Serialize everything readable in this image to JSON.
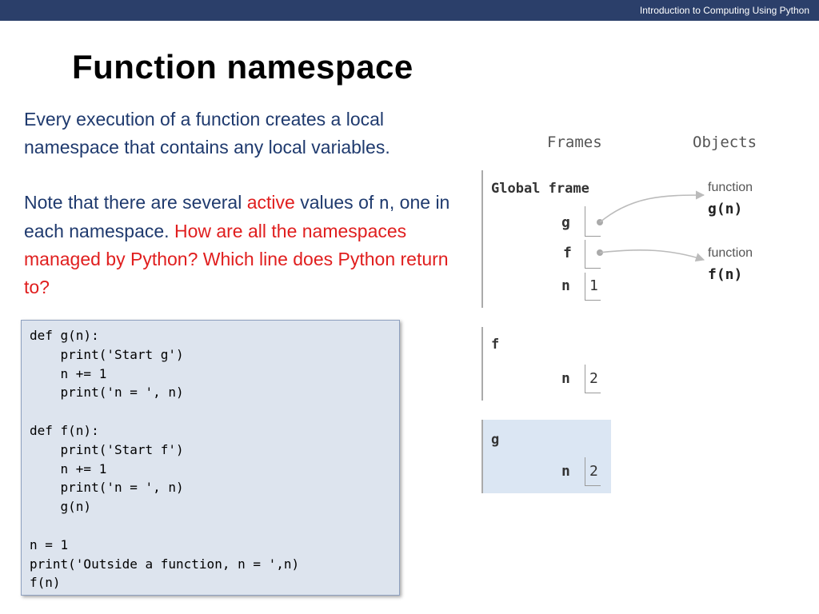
{
  "header": {
    "course": "Introduction to Computing Using Python"
  },
  "slide": {
    "title": "Function namespace",
    "para1": "Every execution of a function creates a local namespace that contains any local variables.",
    "para2_a": "Note that there are several ",
    "para2_active": "active",
    "para2_b": " values of ",
    "para2_code": "n",
    "para2_c": ", one in each namespace. ",
    "para2_question": "How are all the namespaces managed by Python? Which line does Python return to?"
  },
  "code": "def g(n):\n    print('Start g')\n    n += 1\n    print('n = ', n)\n\ndef f(n):\n    print('Start f')\n    n += 1\n    print('n = ', n)\n    g(n)\n\nn = 1\nprint('Outside a function, n = ',n)\nf(n)",
  "visualization": {
    "frames_header": "Frames",
    "objects_header": "Objects",
    "global_frame": {
      "title": "Global frame",
      "vars": [
        {
          "name": "g",
          "value": ""
        },
        {
          "name": "f",
          "value": ""
        },
        {
          "name": "n",
          "value": "1"
        }
      ]
    },
    "f_frame": {
      "title": "f",
      "vars": [
        {
          "name": "n",
          "value": "2"
        }
      ]
    },
    "g_frame": {
      "title": "g",
      "vars": [
        {
          "name": "n",
          "value": "2"
        }
      ]
    },
    "objects": [
      {
        "type": "function",
        "name": "g(n)"
      },
      {
        "type": "function",
        "name": "f(n)"
      }
    ]
  }
}
